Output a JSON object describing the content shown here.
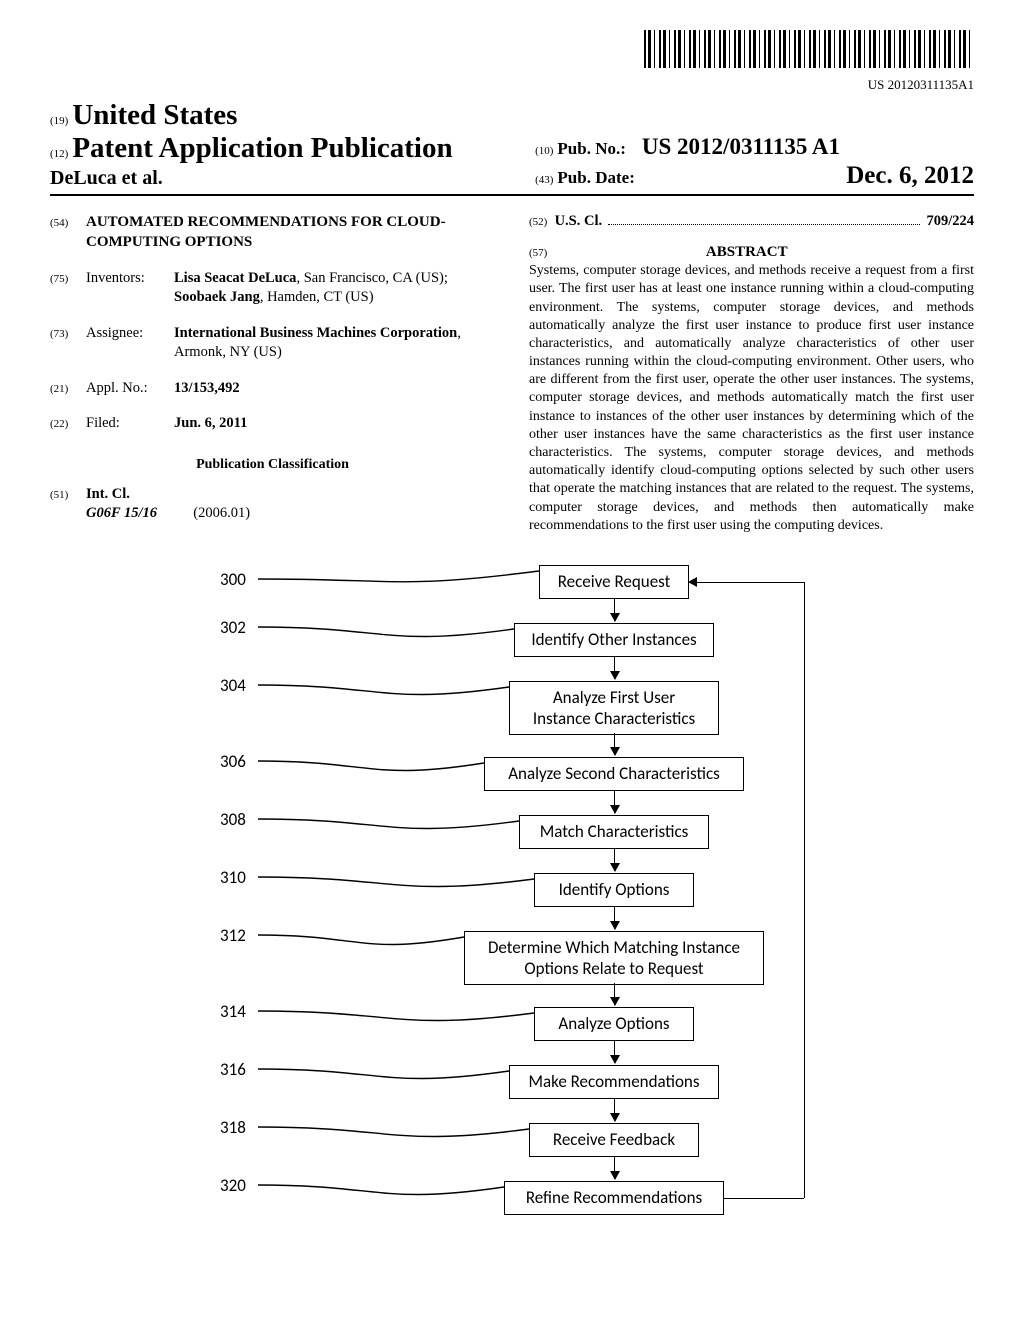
{
  "barcode_number": "US 20120311135A1",
  "header": {
    "code19": "(19)",
    "country": "United States",
    "code12": "(12)",
    "doc_type": "Patent Application Publication",
    "author": "DeLuca et al.",
    "code10": "(10)",
    "pubno_label": "Pub. No.:",
    "pubno_value": "US 2012/0311135 A1",
    "code43": "(43)",
    "pubdate_label": "Pub. Date:",
    "pubdate_value": "Dec. 6, 2012"
  },
  "left": {
    "code54": "(54)",
    "title": "AUTOMATED RECOMMENDATIONS FOR CLOUD-COMPUTING OPTIONS",
    "code75": "(75)",
    "inventors_label": "Inventors:",
    "inventors_html": "<b>Lisa Seacat DeLuca</b>, San Francisco, CA (US); <b>Soobaek Jang</b>, Hamden, CT (US)",
    "code73": "(73)",
    "assignee_label": "Assignee:",
    "assignee_html": "<b>International Business Machines Corporation</b>, Armonk, NY (US)",
    "code21": "(21)",
    "applno_label": "Appl. No.:",
    "applno_value": "13/153,492",
    "code22": "(22)",
    "filed_label": "Filed:",
    "filed_value": "Jun. 6, 2011",
    "pubclass_head": "Publication Classification",
    "code51": "(51)",
    "intcl_label": "Int. Cl.",
    "intcl_code": "G06F 15/16",
    "intcl_ver": "(2006.01)"
  },
  "right": {
    "code52": "(52)",
    "uscl_label": "U.S. Cl.",
    "uscl_value": "709/224",
    "code57": "(57)",
    "abstract_head": "ABSTRACT",
    "abstract_text": "Systems, computer storage devices, and methods receive a request from a first user. The first user has at least one instance running within a cloud-computing environment. The systems, computer storage devices, and methods automatically analyze the first user instance to produce first user instance characteristics, and automatically analyze characteristics of other user instances running within the cloud-computing environment. Other users, who are different from the first user, operate the other user instances. The systems, computer storage devices, and methods automatically match the first user instance to instances of the other user instances by determining which of the other user instances have the same characteristics as the first user instance characteristics. The systems, computer storage devices, and methods automatically identify cloud-computing options selected by such other users that operate the matching instances that are related to the request. The systems, computer storage devices, and methods then automatically make recommendations to the first user using the computing devices."
  },
  "flowchart": {
    "steps": [
      {
        "num": "300",
        "text": "Receive Request"
      },
      {
        "num": "302",
        "text": "Identify Other Instances"
      },
      {
        "num": "304",
        "text": "Analyze First User\nInstance Characteristics"
      },
      {
        "num": "306",
        "text": "Analyze Second Characteristics"
      },
      {
        "num": "308",
        "text": "Match Characteristics"
      },
      {
        "num": "310",
        "text": "Identify Options"
      },
      {
        "num": "312",
        "text": "Determine Which Matching Instance\nOptions Relate to Request"
      },
      {
        "num": "314",
        "text": "Analyze Options"
      },
      {
        "num": "316",
        "text": "Make Recommendations"
      },
      {
        "num": "318",
        "text": "Receive Feedback"
      },
      {
        "num": "320",
        "text": "Refine Recommendations"
      }
    ]
  }
}
